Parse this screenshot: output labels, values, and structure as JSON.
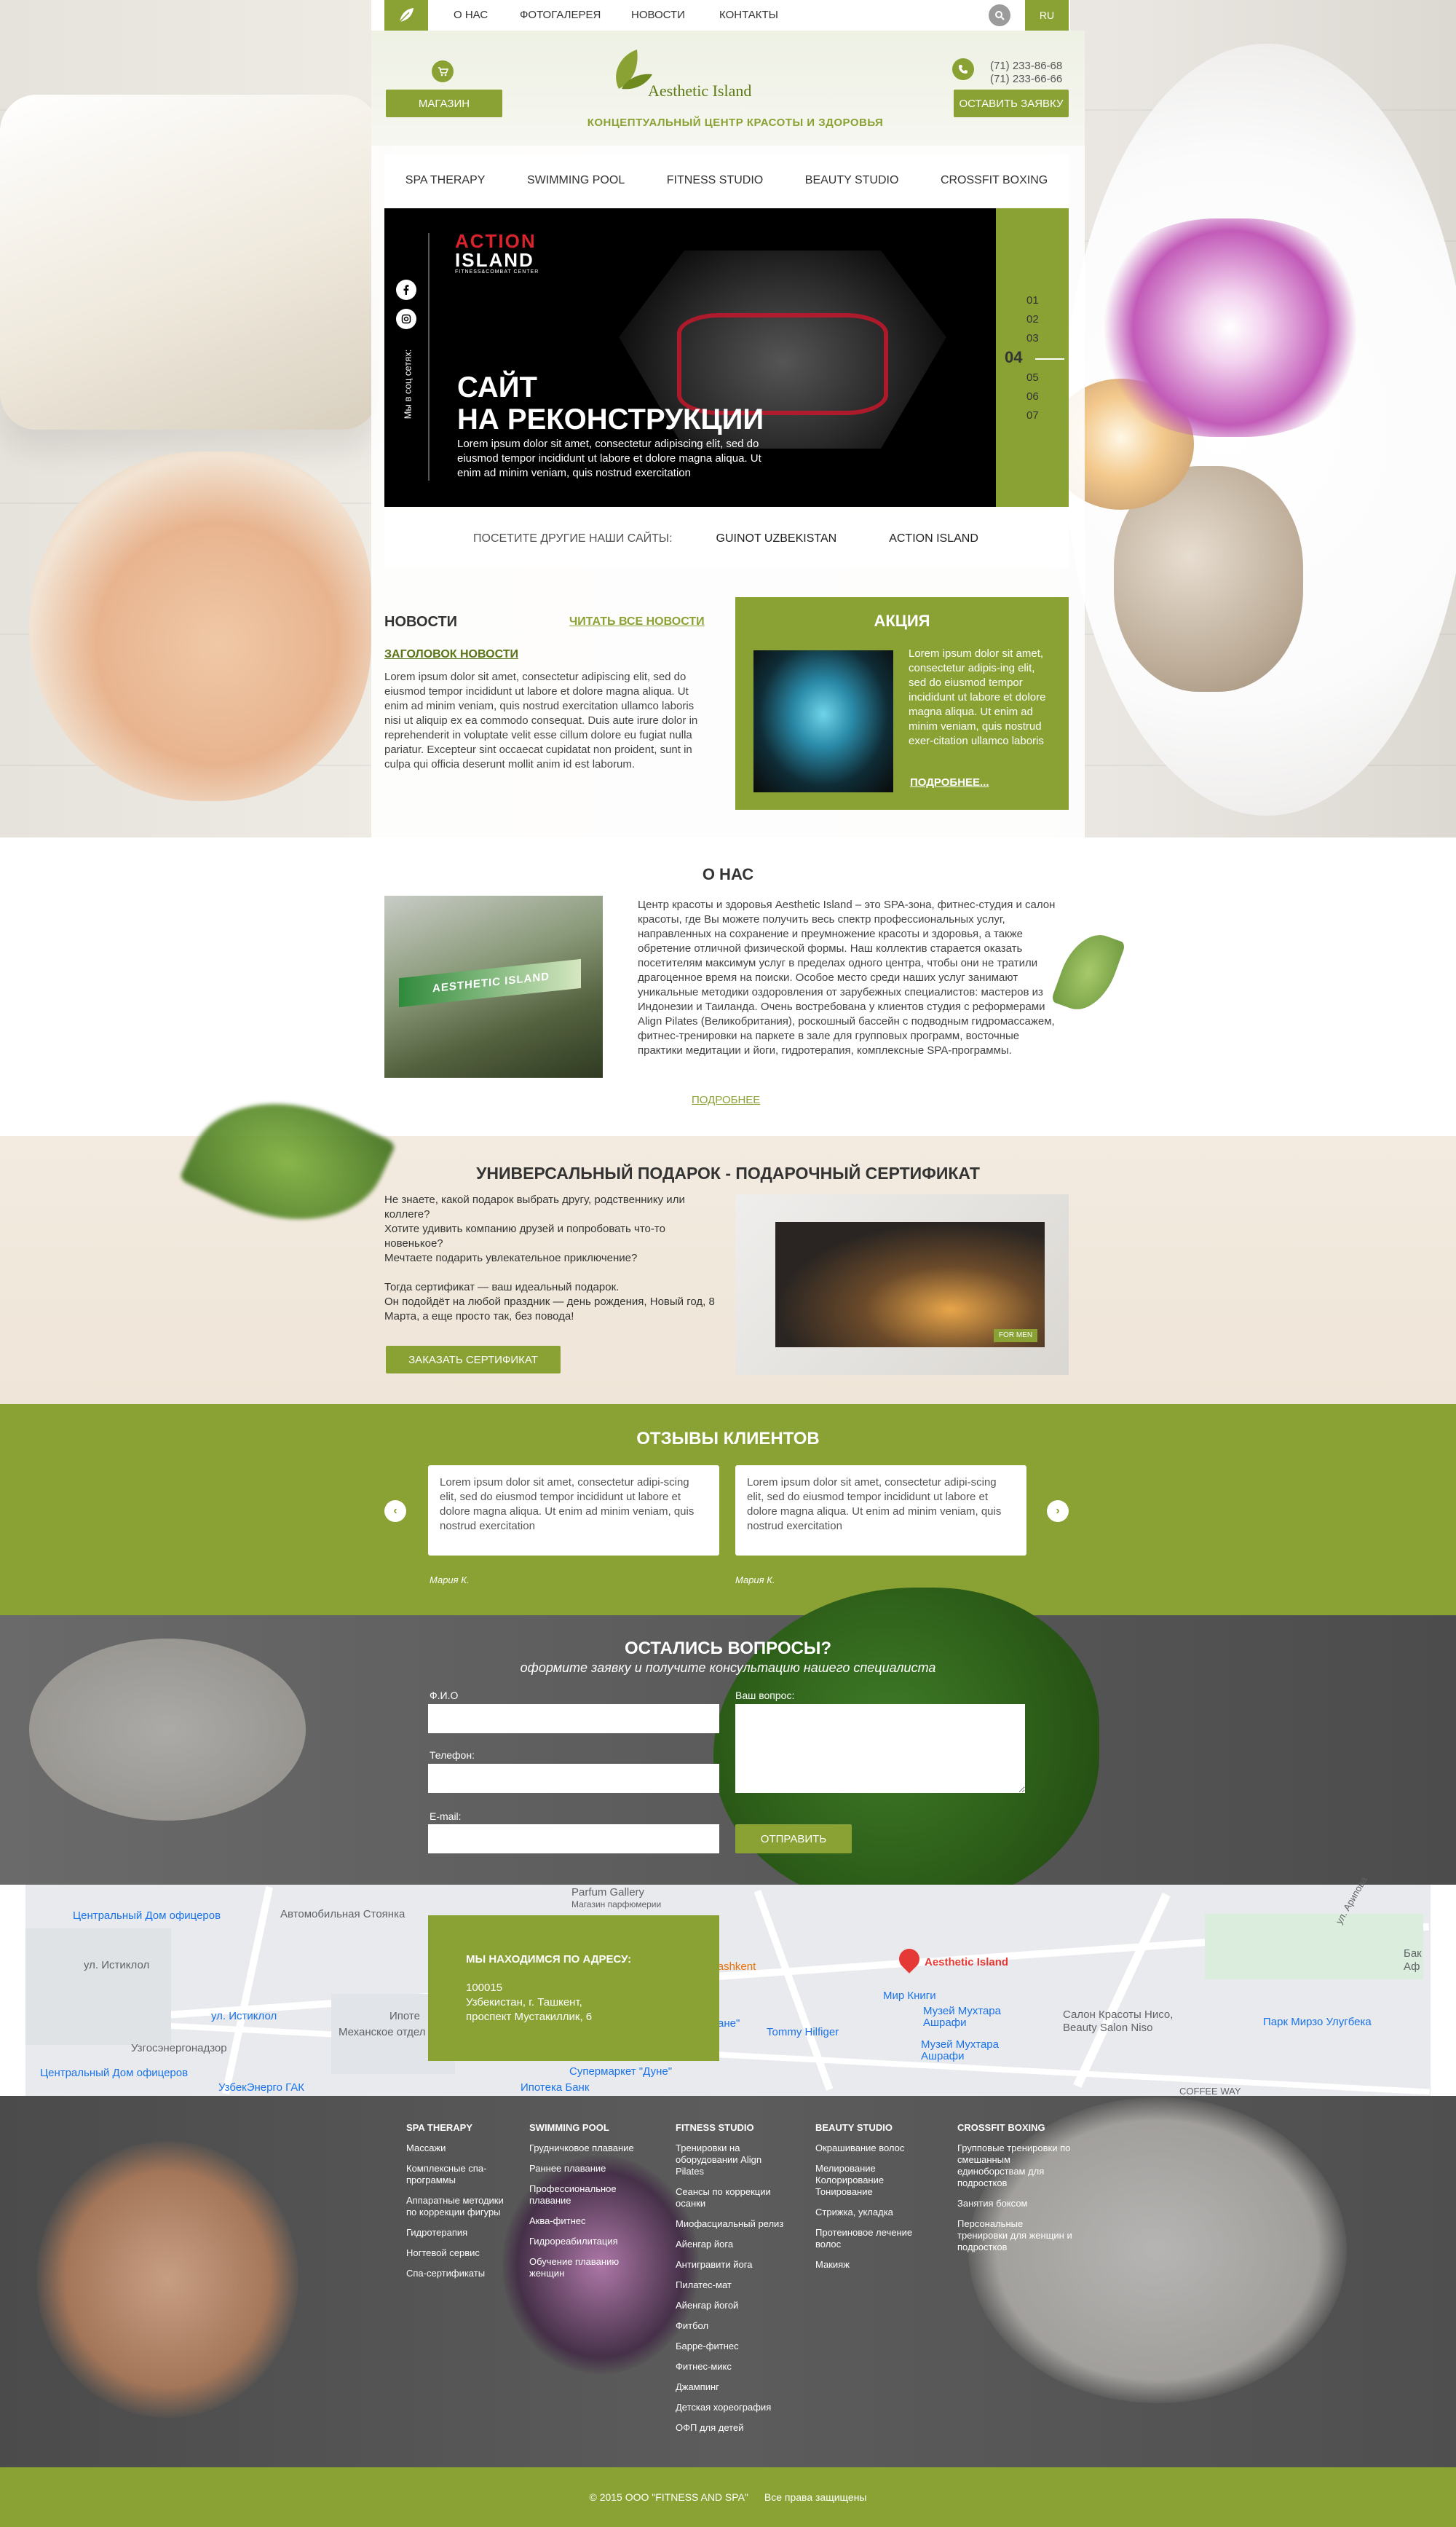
{
  "topnav": {
    "items": [
      "О НАС",
      "ФОТОГАЛЕРЕЯ",
      "НОВОСТИ",
      "КОНТАКТЫ"
    ],
    "lang": "RU"
  },
  "header": {
    "shop_label": "МАГАЗИН",
    "brand_name": "Aesthetic Island",
    "tagline": "КОНЦЕПТУАЛЬНЫЙ ЦЕНТР КРАСОТЫ И ЗДОРОВЬЯ",
    "phone1": "(71) 233-86-68",
    "phone2": "(71) 233-66-66",
    "request_label": "ОСТАВИТЬ ЗАЯВКУ"
  },
  "services": [
    "SPA THERAPY",
    "SWIMMING POOL",
    "FITNESS STUDIO",
    "BEAUTY STUDIO",
    "CROSSFIT BOXING"
  ],
  "slider": {
    "social_label": "Мы в соц сетях:",
    "logo_line1": "ACTION",
    "logo_line2": "ISLAND",
    "logo_sub": "FITNESS&COMBAT CENTER",
    "title_line1": "САЙТ",
    "title_line2": "НА РЕКОНСТРУКЦИИ",
    "text": "Lorem ipsum dolor sit amet, consectetur adipiscing elit, sed do eiusmod tempor incididunt ut labore et dolore magna aliqua. Ut enim ad minim veniam, quis nostrud exercitation",
    "slides": [
      "01",
      "02",
      "03",
      "04",
      "05",
      "06",
      "07"
    ],
    "active_slide": "04"
  },
  "other_sites": {
    "label": "ПОСЕТИТЕ ДРУГИЕ НАШИ САЙТЫ:",
    "site1": "GUINOT UZBEKISTAN",
    "site2": "ACTION ISLAND"
  },
  "news": {
    "heading": "НОВОСТИ",
    "all_link": "ЧИТАТЬ ВСЕ НОВОСТИ",
    "subtitle": "ЗАГОЛОВОК НОВОСТИ",
    "text": "Lorem ipsum dolor sit amet, consectetur adipiscing elit, sed do eiusmod tempor incididunt ut labore et dolore magna aliqua. Ut enim ad minim veniam, quis nostrud exercitation ullamco laboris nisi ut aliquip ex ea commodo consequat. Duis aute irure dolor in reprehenderit in voluptate velit esse cillum dolore eu fugiat nulla pariatur. Excepteur sint occaecat cupidatat non proident, sunt in culpa qui officia deserunt mollit anim id est laborum."
  },
  "promo": {
    "heading": "АКЦИЯ",
    "text": "Lorem ipsum dolor sit amet, consectetur adipis-ing elit, sed do eiusmod tempor incididunt ut labore et dolore magna aliqua. Ut enim ad minim veniam, quis nostrud exer-citation ullamco laboris",
    "more": "ПОДРОБНЕЕ..."
  },
  "about": {
    "heading": "О НАС",
    "sign_text": "AESTHETIC ISLAND",
    "text": "Центр красоты и здоровья Aesthetic Island – это SPA-зона, фитнес-студия и салон красоты, где Вы можете получить весь спектр профессиональных услуг, направленных на сохранение и преумножение красоты и здоровья, а также обретение отличной физической формы. Наш коллектив старается оказать посетителям максимум услуг в пределах одного центра, чтобы они не тратили драгоценное время на поиски. Особое место среди наших услуг занимают уникальные методики оздоровления от зарубежных специалистов: мастеров из Индонезии и Таиланда. Очень востребована у клиентов студия с реформерами Align Pilates (Великобритания), роскошный бассейн с подводным гидромассажем, фитнес-тренировки на паркете в зале для групповых программ, восточные практики медитации и йоги, гидротерапия, комплексные SPA-программы.",
    "more": "ПОДРОБНЕЕ"
  },
  "gift": {
    "heading": "УНИВЕРСАЛЬНЫЙ ПОДАРОК - ПОДАРОЧНЫЙ СЕРТИФИКАТ",
    "text1": "Не знаете, какой подарок выбрать другу, родственнику или коллеге?",
    "text2": "Хотите удивить компанию друзей и попробовать что-то новенькое?",
    "text3": "Мечтаете подарить увлекательное приключение?",
    "text4": "Тогда сертификат — ваш идеальный подарок.",
    "text5": "Он подойдёт на любой праздник — день рождения, Новый год, 8 Марта, а еще просто так, без повода!",
    "button": "ЗАКАЗАТЬ СЕРТИФИКАТ",
    "tag": "FOR MEN"
  },
  "reviews": {
    "heading": "ОТЗЫВЫ КЛИЕНТОВ",
    "items": [
      {
        "text": "Lorem ipsum dolor sit amet, consectetur adipi-scing elit, sed do eiusmod tempor incididunt ut labore et dolore magna aliqua. Ut enim ad minim veniam, quis nostrud exercitation",
        "author": "Мария К."
      },
      {
        "text": "Lorem ipsum dolor sit amet, consectetur adipi-scing elit, sed do eiusmod tempor incididunt ut labore et dolore magna aliqua. Ut enim ad minim veniam, quis nostrud exercitation",
        "author": "Мария К."
      }
    ]
  },
  "contact": {
    "heading": "ОСТАЛИСЬ ВОПРОСЫ?",
    "subheading": "оформите заявку и получите консультацию нашего специалиста",
    "name_label": "Ф.И.О",
    "phone_label": "Телефон:",
    "email_label": "E-mail:",
    "question_label": "Ваш вопрос:",
    "submit": "ОТПРАВИТЬ"
  },
  "map": {
    "address_heading": "МЫ НАХОДИМСЯ ПО АДРЕСУ:",
    "postcode": "100015",
    "address_line1": "Узбекистан, г. Ташкент,",
    "address_line2": "проспект Мустакиллик, 6",
    "labels": {
      "officers": "Центральный\nДом офицеров",
      "parking": "Автомобильная Стоянка",
      "parfum": "Parfum Gallery",
      "parfum_sub": "Магазин парфюмерии",
      "istiklol": "ул. Истиклол",
      "istiklol_street": "ул. Истиклол",
      "ipoteka": "Ипотека Банк",
      "mekhanskoe": "Механское отдел",
      "ipote": "Ипоте",
      "uzgas": "Узгосэнергонадзор",
      "uzbekenergo": "УзбекЭнерго ГАК",
      "officers2": "Центральный\nДом офицеров",
      "tashkent": "e Tashkent",
      "dune": "Супермаркет \"Дуне\"",
      "dune2": "ане\"",
      "tommy": "Tommy Hilfiger",
      "mir": "Мир Книги",
      "museum1": "Музей Мухтара\nАшрафи",
      "museum2": "Музей Мухтара\nАшрафи",
      "aesthetic": "Aesthetic Island",
      "salon": "Салон Красоты Нисо,\nBeauty Salon Niso",
      "park": "Парк Мирзо Улугбека",
      "bank": "Бак\nАф",
      "arifova": "ул. Арипова",
      "coffee": "COFFEE WAY"
    }
  },
  "footer": {
    "columns": [
      {
        "heading": "SPA THERAPY",
        "items": [
          "Массажи",
          "Комплексные спа-программы",
          "Аппаратные методики по коррекции фигуры",
          "Гидротерапия",
          "Ногтевой сервис",
          "Спа-сертификаты"
        ]
      },
      {
        "heading": "SWIMMING POOL",
        "items": [
          "Грудничковое плавание",
          "Раннее плавание",
          "Профессиональное плавание",
          "Аква-фитнес",
          "Гидрореабилитация",
          "Обучение плаванию женщин"
        ]
      },
      {
        "heading": "FITNESS STUDIO",
        "items": [
          "Тренировки на оборудовании Align Pilates",
          "Сеансы по коррекции осанки",
          "Миофасциальный релиз",
          "Айенгар йога",
          "Антигравити йога",
          "Пилатес-мат",
          "Айенгар йогой",
          "Фитбол",
          "Барре-фитнес",
          "Фитнес-микс",
          "Джампинг",
          "Детская хореография",
          "ОФП для детей"
        ]
      },
      {
        "heading": "BEAUTY STUDIO",
        "items": [
          "Окрашивание волос",
          "Мелирование Колорирование Тонирование",
          "Стрижка, укладка",
          "Протеиновое лечение волос",
          "Макияж"
        ]
      },
      {
        "heading": "CROSSFIT BOXING",
        "items": [
          "Групповые тренировки по смешанным единоборствам для подростков",
          "Занятия боксом",
          "Персональные тренировки для женщин и подростков"
        ]
      }
    ],
    "copyright": "© 2015 ООО \"FITNESS AND SPA\"",
    "rights": "Все права защищены"
  },
  "colors": {
    "accent": "#8aa133",
    "dark": "#555555"
  },
  "icons": [
    "leaf-icon",
    "search-icon",
    "cart-icon",
    "phone-icon",
    "facebook-icon",
    "instagram-icon",
    "arrow-left-icon",
    "arrow-right-icon",
    "map-pin-icon"
  ]
}
